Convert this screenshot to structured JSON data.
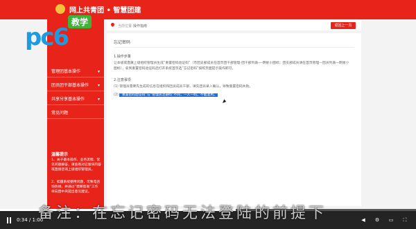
{
  "header": {
    "brand": "网上共青团 • 智慧团建"
  },
  "watermark": {
    "logo_text": "pc6",
    "tag": "教学"
  },
  "sidebar": {
    "items": [
      {
        "label": "管理团基本操作"
      },
      {
        "label": "团员团干部基本操作"
      },
      {
        "label": "共享分享基本操作"
      },
      {
        "label": "常见问题"
      }
    ],
    "note_title": "温馨提示",
    "notes": [
      "1、关于基本操作、业务流程、常见问题解答，请查看对应版块内容或直接咨询上级组织管理员。",
      "2、如遇系统使用问题，可致电咨询热线，并通过“需要帮助”工作单向团中央提出意见建议。"
    ]
  },
  "breadcrumb": {
    "label": "当前位置:",
    "link": "操作指南"
  },
  "back_button": "返回上一页",
  "article": {
    "title": "忘记密码",
    "sec1": "1.操作步骤",
    "para1": "让本级或直属上级组织管理员生成“重置密码验证码”（市团支部成员在首页团干部管理-团干部列表—-明星小图标；团支部成员请在首页管理—团员列表—明星小图标），拿到重置密码验证码后打开系统首页选“忘记密码”按照页面提示操作即可。",
    "sec2": "2.注意事项",
    "note1": "(1) 管理员需要先生成的信息在组织和团员成员干部，请先团员录入确认，导致重置密码失败。",
    "note2_prefix": "(2)",
    "note2_selected": "“重置密码验证码”与“管理员注册码”不同，一人一码，不能混用。"
  },
  "player": {
    "time": "0:34 / 1:00",
    "progress_fraction": 0.567,
    "subtitle": "备注：在忘记密码无法登陆的前提下"
  },
  "colors": {
    "brand_red": "#e8231a",
    "selection_blue": "#1e6fe0"
  }
}
